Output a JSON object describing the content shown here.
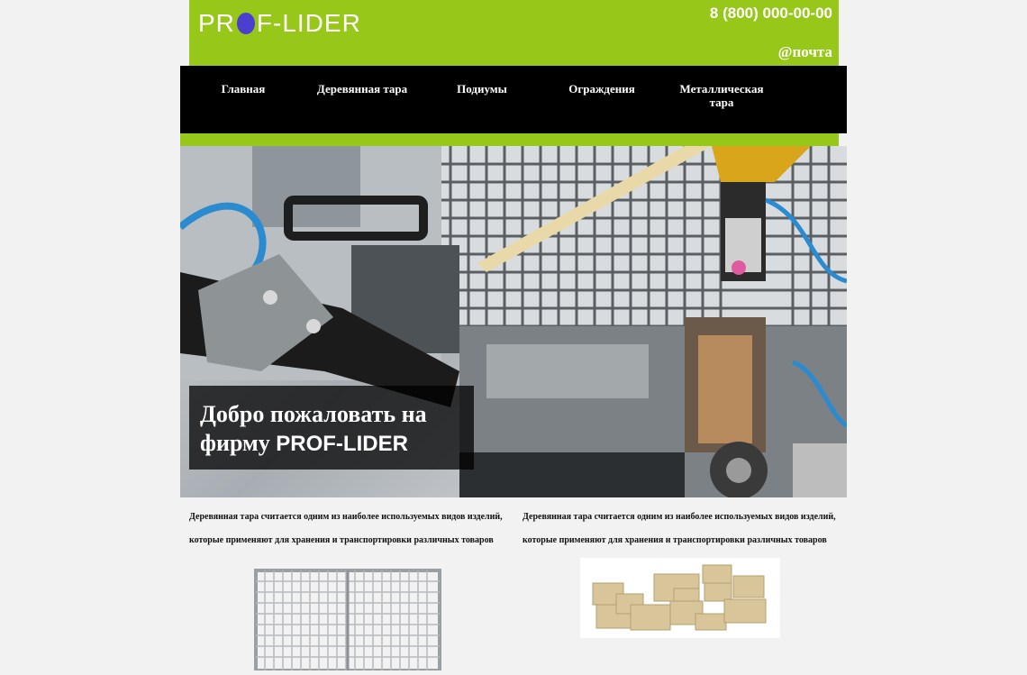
{
  "header": {
    "logo_left": "PR",
    "logo_right": "F-LIDER",
    "phone": "8 (800) 000-00-00",
    "email": "@почта",
    "brand_color": "#97c718",
    "logo_dot_color": "#4a3fd1"
  },
  "nav": {
    "items": [
      {
        "label": "Главная"
      },
      {
        "label": "Деревянная тара"
      },
      {
        "label": "Подиумы"
      },
      {
        "label": "Ограждения"
      },
      {
        "label": "Металлическая тара"
      }
    ]
  },
  "hero": {
    "welcome_line": "Добро пожаловать на фирму",
    "welcome_brand": "PROF-LIDER",
    "image_subject": "industrial-robot-welding-cell"
  },
  "content": {
    "left_text": "Деревянная тара считается одним из наиболее используемых видов изделий, которые применяют для хранения и транспортировки различных товаров",
    "right_text": "Деревянная тара считается одним из наиболее используемых видов изделий, которые применяют для хранения и транспортировки различных товаров",
    "left_image": "metal-mesh-cage-container",
    "right_image": "wooden-crates-stack"
  }
}
